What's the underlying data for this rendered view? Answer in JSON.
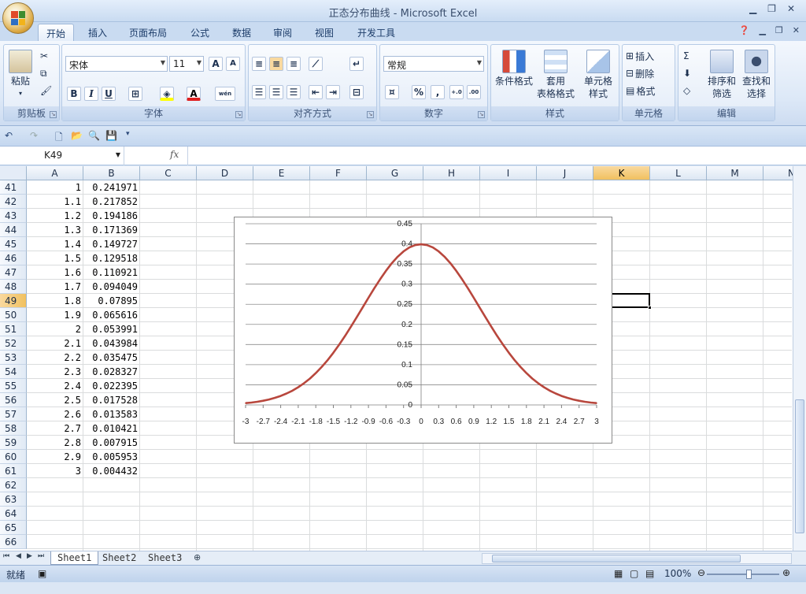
{
  "window": {
    "title": "正态分布曲线 - Microsoft Excel"
  },
  "tabs": [
    "开始",
    "插入",
    "页面布局",
    "公式",
    "数据",
    "审阅",
    "视图",
    "开发工具"
  ],
  "ribbon": {
    "clipboard": {
      "label": "剪贴板",
      "paste": "粘贴"
    },
    "font": {
      "label": "字体",
      "name": "宋体",
      "size": "11",
      "bold": "B",
      "italic": "I",
      "underline": "U",
      "grow": "A",
      "shrink": "A",
      "wen": "wén"
    },
    "alignment": {
      "label": "对齐方式"
    },
    "number": {
      "label": "数字",
      "format": "常规",
      "percent": "%",
      "comma": ",",
      "inc": "+.0",
      "dec": ".00"
    },
    "styles": {
      "label": "样式",
      "conditional": "条件格式",
      "table_a": "套用",
      "table_b": "表格格式",
      "cell_a": "单元格",
      "cell_b": "样式"
    },
    "cells": {
      "label": "单元格",
      "insert": "插入",
      "delete": "删除",
      "format": "格式"
    },
    "editing": {
      "label": "编辑",
      "sort_a": "排序和",
      "sort_b": "筛选",
      "find_a": "查找和",
      "find_b": "选择"
    }
  },
  "formula_bar": {
    "name_box": "K49",
    "fx": "fx",
    "formula": ""
  },
  "columns": [
    "A",
    "B",
    "C",
    "D",
    "E",
    "F",
    "G",
    "H",
    "I",
    "J",
    "K",
    "L",
    "M",
    "N"
  ],
  "selected_cell": "K49",
  "rows": [
    {
      "r": "41",
      "a": "1",
      "b": "0.241971"
    },
    {
      "r": "42",
      "a": "1.1",
      "b": "0.217852"
    },
    {
      "r": "43",
      "a": "1.2",
      "b": "0.194186"
    },
    {
      "r": "44",
      "a": "1.3",
      "b": "0.171369"
    },
    {
      "r": "45",
      "a": "1.4",
      "b": "0.149727"
    },
    {
      "r": "46",
      "a": "1.5",
      "b": "0.129518"
    },
    {
      "r": "47",
      "a": "1.6",
      "b": "0.110921"
    },
    {
      "r": "48",
      "a": "1.7",
      "b": "0.094049"
    },
    {
      "r": "49",
      "a": "1.8",
      "b": "0.07895"
    },
    {
      "r": "50",
      "a": "1.9",
      "b": "0.065616"
    },
    {
      "r": "51",
      "a": "2",
      "b": "0.053991"
    },
    {
      "r": "52",
      "a": "2.1",
      "b": "0.043984"
    },
    {
      "r": "53",
      "a": "2.2",
      "b": "0.035475"
    },
    {
      "r": "54",
      "a": "2.3",
      "b": "0.028327"
    },
    {
      "r": "55",
      "a": "2.4",
      "b": "0.022395"
    },
    {
      "r": "56",
      "a": "2.5",
      "b": "0.017528"
    },
    {
      "r": "57",
      "a": "2.6",
      "b": "0.013583"
    },
    {
      "r": "58",
      "a": "2.7",
      "b": "0.010421"
    },
    {
      "r": "59",
      "a": "2.8",
      "b": "0.007915"
    },
    {
      "r": "60",
      "a": "2.9",
      "b": "0.005953"
    },
    {
      "r": "61",
      "a": "3",
      "b": "0.004432"
    },
    {
      "r": "62",
      "a": "",
      "b": ""
    },
    {
      "r": "63",
      "a": "",
      "b": ""
    },
    {
      "r": "64",
      "a": "",
      "b": ""
    },
    {
      "r": "65",
      "a": "",
      "b": ""
    },
    {
      "r": "66",
      "a": "",
      "b": ""
    }
  ],
  "sheets": [
    "Sheet1",
    "Sheet2",
    "Sheet3"
  ],
  "active_sheet": "Sheet1",
  "status": {
    "ready": "就绪",
    "zoom": "100%"
  },
  "colors": {
    "curve": "#b8473d",
    "selected_header": "#f4c468",
    "ribbon": "#dce8f7"
  },
  "chart_data": {
    "type": "line",
    "x": [
      -3,
      -2.9,
      -2.8,
      -2.7,
      -2.6,
      -2.5,
      -2.4,
      -2.3,
      -2.2,
      -2.1,
      -2,
      -1.9,
      -1.8,
      -1.7,
      -1.6,
      -1.5,
      -1.4,
      -1.3,
      -1.2,
      -1.1,
      -1,
      -0.9,
      -0.8,
      -0.7,
      -0.6,
      -0.5,
      -0.4,
      -0.3,
      -0.2,
      -0.1,
      0,
      0.1,
      0.2,
      0.3,
      0.4,
      0.5,
      0.6,
      0.7,
      0.8,
      0.9,
      1,
      1.1,
      1.2,
      1.3,
      1.4,
      1.5,
      1.6,
      1.7,
      1.8,
      1.9,
      2,
      2.1,
      2.2,
      2.3,
      2.4,
      2.5,
      2.6,
      2.7,
      2.8,
      2.9,
      3
    ],
    "series": [
      {
        "values": [
          0.004432,
          0.005953,
          0.007915,
          0.010421,
          0.013583,
          0.017528,
          0.022395,
          0.028327,
          0.035475,
          0.043984,
          0.053991,
          0.065616,
          0.07895,
          0.094049,
          0.110921,
          0.129518,
          0.149727,
          0.171369,
          0.194186,
          0.217852,
          0.241971,
          0.266085,
          0.289692,
          0.312254,
          0.333225,
          0.352065,
          0.36827,
          0.381388,
          0.391043,
          0.396953,
          0.398942,
          0.396953,
          0.391043,
          0.381388,
          0.36827,
          0.352065,
          0.333225,
          0.312254,
          0.289692,
          0.266085,
          0.241971,
          0.217852,
          0.194186,
          0.171369,
          0.149727,
          0.129518,
          0.110921,
          0.094049,
          0.07895,
          0.065616,
          0.053991,
          0.043984,
          0.035475,
          0.028327,
          0.022395,
          0.017528,
          0.013583,
          0.010421,
          0.007915,
          0.005953,
          0.004432
        ]
      }
    ],
    "x_tick_labels": [
      "-3",
      "-2.7",
      "-2.4",
      "-2.1",
      "-1.8",
      "-1.5",
      "-1.2",
      "-0.9",
      "-0.6",
      "-0.3",
      "0",
      "0.3",
      "0.6",
      "0.9",
      "1.2",
      "1.5",
      "1.8",
      "2.1",
      "2.4",
      "2.7",
      "3"
    ],
    "y_tick_labels": [
      "0",
      "0.05",
      "0.1",
      "0.15",
      "0.2",
      "0.25",
      "0.3",
      "0.35",
      "0.4",
      "0.45"
    ],
    "ylim": [
      0,
      0.45
    ],
    "grid": true,
    "title": "",
    "xlabel": "",
    "ylabel": ""
  }
}
